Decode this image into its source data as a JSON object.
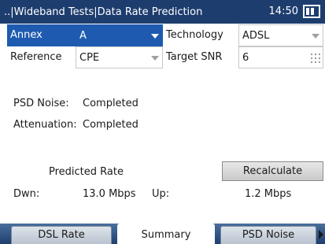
{
  "titlebar": {
    "title": "..|Wideband Tests|Data Rate Prediction",
    "clock": "14:50"
  },
  "form": {
    "annex": {
      "label": "Annex",
      "value": "A"
    },
    "technology": {
      "label": "Technology",
      "value": "ADSL"
    },
    "reference": {
      "label": "Reference",
      "value": "CPE"
    },
    "target_snr": {
      "label": "Target SNR",
      "value": "6"
    }
  },
  "status": {
    "psd_noise": {
      "label": "PSD Noise:",
      "value": "Completed"
    },
    "attenuation": {
      "label": "Attenuation:",
      "value": "Completed"
    }
  },
  "prediction": {
    "title": "Predicted Rate",
    "recalculate_label": "Recalculate",
    "down_label": "Dwn:",
    "down_value": "13.0 Mbps",
    "up_label": "Up:",
    "up_value": "1.2 Mbps"
  },
  "tabs": [
    {
      "label": "DSL Rate",
      "active": false
    },
    {
      "label": "Summary",
      "active": true
    },
    {
      "label": "PSD Noise",
      "active": false
    }
  ],
  "colors": {
    "titlebar": "#1d3d6e",
    "selection": "#1e5bb0"
  }
}
